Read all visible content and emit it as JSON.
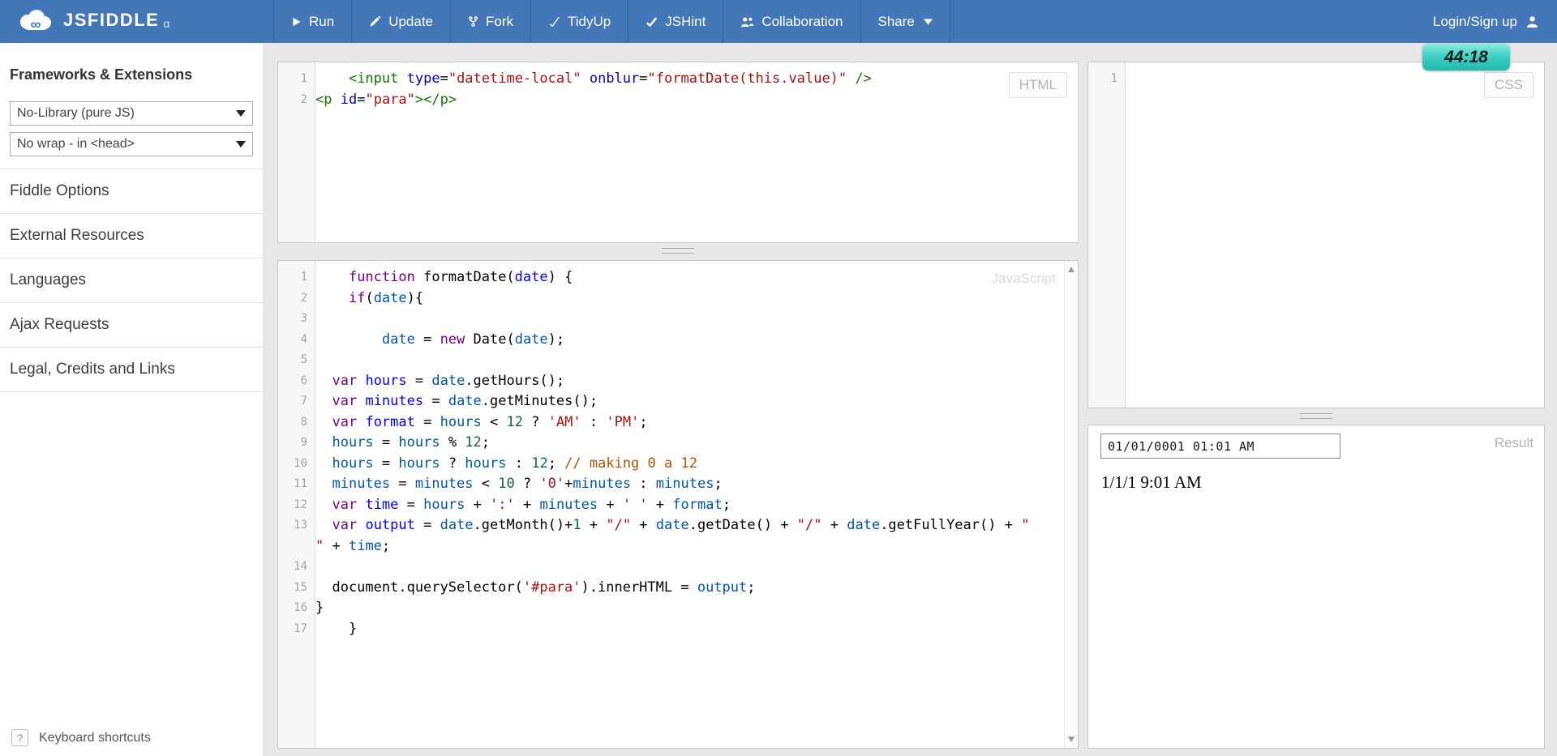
{
  "nav": {
    "logo": "JSFIDDLE",
    "alpha": "α",
    "items": [
      {
        "id": "run",
        "label": "Run",
        "icon": "play"
      },
      {
        "id": "update",
        "label": "Update",
        "icon": "pencil"
      },
      {
        "id": "fork",
        "label": "Fork",
        "icon": "fork"
      },
      {
        "id": "tidyup",
        "label": "TidyUp",
        "icon": "tidy-check"
      },
      {
        "id": "jshint",
        "label": "JSHint",
        "icon": "bold-check"
      },
      {
        "id": "collaboration",
        "label": "Collaboration",
        "icon": "people"
      },
      {
        "id": "share",
        "label": "Share",
        "icon": null,
        "caret": true
      }
    ],
    "login": "Login/Sign up",
    "timer": "44:18"
  },
  "sidebar": {
    "heading": "Frameworks & Extensions",
    "selects": [
      {
        "id": "library-select",
        "value": "No-Library (pure JS)"
      },
      {
        "id": "wrap-select",
        "value": "No wrap - in <head>"
      }
    ],
    "items": [
      {
        "id": "fiddle-options",
        "label": "Fiddle Options"
      },
      {
        "id": "external-resources",
        "label": "External Resources"
      },
      {
        "id": "languages",
        "label": "Languages"
      },
      {
        "id": "ajax-requests",
        "label": "Ajax Requests"
      },
      {
        "id": "legal-credits",
        "label": "Legal, Credits and Links"
      }
    ],
    "help_icon": "?",
    "keyboard_shortcuts": "Keyboard shortcuts"
  },
  "editors": {
    "html": {
      "label": "HTML",
      "lines": [
        {
          "n": "1",
          "seg": [
            [
              "plain",
              "    "
            ],
            [
              "tag",
              "<input"
            ],
            [
              "plain",
              " "
            ],
            [
              "attr",
              "type"
            ],
            [
              "plain",
              "="
            ],
            [
              "str",
              "\"datetime-local\""
            ],
            [
              "plain",
              " "
            ],
            [
              "attr",
              "onblur"
            ],
            [
              "plain",
              "="
            ],
            [
              "str",
              "\"formatDate(this.value)\""
            ],
            [
              "plain",
              " "
            ],
            [
              "tag",
              "/>"
            ]
          ]
        },
        {
          "n": "2",
          "seg": [
            [
              "tag",
              "<p"
            ],
            [
              "plain",
              " "
            ],
            [
              "attr",
              "id"
            ],
            [
              "plain",
              "="
            ],
            [
              "str",
              "\"para\""
            ],
            [
              "tag",
              "></p>"
            ]
          ]
        }
      ]
    },
    "css": {
      "label": "CSS",
      "lines": [
        {
          "n": "1",
          "seg": []
        }
      ]
    },
    "js": {
      "watermark": "JavaScript",
      "lines": [
        {
          "n": "1",
          "seg": [
            [
              "plain",
              "    "
            ],
            [
              "kw",
              "function"
            ],
            [
              "plain",
              " formatDate("
            ],
            [
              "def",
              "date"
            ],
            [
              "plain",
              ") {"
            ]
          ]
        },
        {
          "n": "2",
          "seg": [
            [
              "plain",
              "    "
            ],
            [
              "kw",
              "if"
            ],
            [
              "plain",
              "("
            ],
            [
              "var2",
              "date"
            ],
            [
              "plain",
              "){"
            ]
          ]
        },
        {
          "n": "3",
          "seg": []
        },
        {
          "n": "4",
          "seg": [
            [
              "plain",
              "        "
            ],
            [
              "var2",
              "date"
            ],
            [
              "plain",
              " = "
            ],
            [
              "kw",
              "new"
            ],
            [
              "plain",
              " Date("
            ],
            [
              "var2",
              "date"
            ],
            [
              "plain",
              ");"
            ]
          ]
        },
        {
          "n": "5",
          "seg": []
        },
        {
          "n": "6",
          "seg": [
            [
              "plain",
              "  "
            ],
            [
              "kw",
              "var"
            ],
            [
              "plain",
              " "
            ],
            [
              "def",
              "hours"
            ],
            [
              "plain",
              " = "
            ],
            [
              "var2",
              "date"
            ],
            [
              "plain",
              ".getHours();"
            ]
          ]
        },
        {
          "n": "7",
          "seg": [
            [
              "plain",
              "  "
            ],
            [
              "kw",
              "var"
            ],
            [
              "plain",
              " "
            ],
            [
              "def",
              "minutes"
            ],
            [
              "plain",
              " = "
            ],
            [
              "var2",
              "date"
            ],
            [
              "plain",
              ".getMinutes();"
            ]
          ]
        },
        {
          "n": "8",
          "seg": [
            [
              "plain",
              "  "
            ],
            [
              "kw",
              "var"
            ],
            [
              "plain",
              " "
            ],
            [
              "def",
              "format"
            ],
            [
              "plain",
              " = "
            ],
            [
              "var2",
              "hours"
            ],
            [
              "plain",
              " < "
            ],
            [
              "num",
              "12"
            ],
            [
              "plain",
              " ? "
            ],
            [
              "str",
              "'AM'"
            ],
            [
              "plain",
              " : "
            ],
            [
              "str",
              "'PM'"
            ],
            [
              "plain",
              ";"
            ]
          ]
        },
        {
          "n": "9",
          "seg": [
            [
              "plain",
              "  "
            ],
            [
              "var2",
              "hours"
            ],
            [
              "plain",
              " = "
            ],
            [
              "var2",
              "hours"
            ],
            [
              "plain",
              " % "
            ],
            [
              "num",
              "12"
            ],
            [
              "plain",
              ";"
            ]
          ]
        },
        {
          "n": "10",
          "seg": [
            [
              "plain",
              "  "
            ],
            [
              "var2",
              "hours"
            ],
            [
              "plain",
              " = "
            ],
            [
              "var2",
              "hours"
            ],
            [
              "plain",
              " ? "
            ],
            [
              "var2",
              "hours"
            ],
            [
              "plain",
              " : "
            ],
            [
              "num",
              "12"
            ],
            [
              "plain",
              "; "
            ],
            [
              "cmt",
              "// making 0 a 12"
            ]
          ]
        },
        {
          "n": "11",
          "seg": [
            [
              "plain",
              "  "
            ],
            [
              "var2",
              "minutes"
            ],
            [
              "plain",
              " = "
            ],
            [
              "var2",
              "minutes"
            ],
            [
              "plain",
              " < "
            ],
            [
              "num",
              "10"
            ],
            [
              "plain",
              " ? "
            ],
            [
              "str",
              "'0'"
            ],
            [
              "plain",
              "+"
            ],
            [
              "var2",
              "minutes"
            ],
            [
              "plain",
              " : "
            ],
            [
              "var2",
              "minutes"
            ],
            [
              "plain",
              ";"
            ]
          ]
        },
        {
          "n": "12",
          "seg": [
            [
              "plain",
              "  "
            ],
            [
              "kw",
              "var"
            ],
            [
              "plain",
              " "
            ],
            [
              "def",
              "time"
            ],
            [
              "plain",
              " = "
            ],
            [
              "var2",
              "hours"
            ],
            [
              "plain",
              " + "
            ],
            [
              "str",
              "':'"
            ],
            [
              "plain",
              " + "
            ],
            [
              "var2",
              "minutes"
            ],
            [
              "plain",
              " + "
            ],
            [
              "str",
              "' '"
            ],
            [
              "plain",
              " + "
            ],
            [
              "var2",
              "format"
            ],
            [
              "plain",
              ";"
            ]
          ]
        },
        {
          "n": "13",
          "seg": [
            [
              "plain",
              "  "
            ],
            [
              "kw",
              "var"
            ],
            [
              "plain",
              " "
            ],
            [
              "def",
              "output"
            ],
            [
              "plain",
              " = "
            ],
            [
              "var2",
              "date"
            ],
            [
              "plain",
              ".getMonth()+"
            ],
            [
              "num",
              "1"
            ],
            [
              "plain",
              " + "
            ],
            [
              "str",
              "\"/\""
            ],
            [
              "plain",
              " + "
            ],
            [
              "var2",
              "date"
            ],
            [
              "plain",
              ".getDate() + "
            ],
            [
              "str",
              "\"/\""
            ],
            [
              "plain",
              " + "
            ],
            [
              "var2",
              "date"
            ],
            [
              "plain",
              ".getFullYear() + "
            ],
            [
              "str",
              "\""
            ]
          ]
        },
        {
          "n": "",
          "seg": [
            [
              "str",
              "\""
            ],
            [
              "plain",
              " + "
            ],
            [
              "var2",
              "time"
            ],
            [
              "plain",
              ";"
            ]
          ]
        },
        {
          "n": "14",
          "seg": []
        },
        {
          "n": "15",
          "seg": [
            [
              "plain",
              "  document.querySelector("
            ],
            [
              "str",
              "'#para'"
            ],
            [
              "plain",
              ").innerHTML = "
            ],
            [
              "var2",
              "output"
            ],
            [
              "plain",
              ";"
            ]
          ]
        },
        {
          "n": "16",
          "seg": [
            [
              "plain",
              "}"
            ]
          ]
        },
        {
          "n": "17",
          "seg": [
            [
              "plain",
              "    }"
            ]
          ]
        }
      ]
    }
  },
  "result": {
    "label": "Result",
    "input_value": "01/01/0001 01:01 AM",
    "output_text": "1/1/1 9:01 AM"
  },
  "colors": {
    "navbar_blue": "#4377b7",
    "timer_teal": "#2cc6ba",
    "keyword_purple": "#770088",
    "string_red": "#aa1111",
    "comment_orange": "#aa5500",
    "number_green": "#116644",
    "local_var_blue": "#0055aa",
    "def_blue": "#0000ff",
    "tag_green": "#117700",
    "attr_blue": "#0000cc"
  }
}
